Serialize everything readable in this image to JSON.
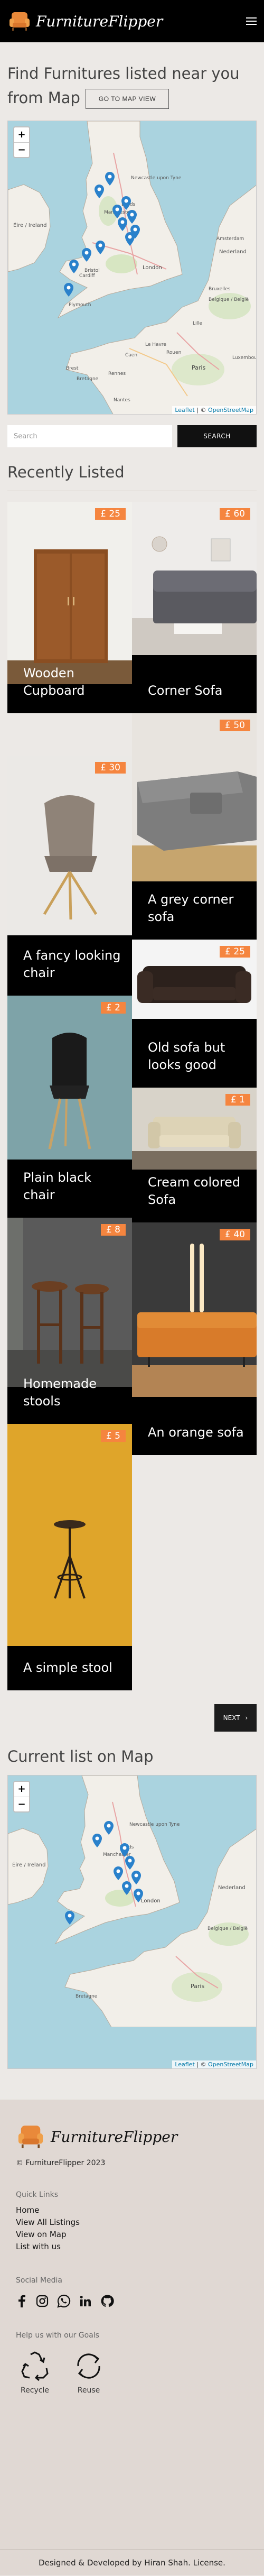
{
  "header": {
    "brand": "FurnitureFlipper"
  },
  "hero": {
    "title": "Find Furnitures listed near you from Map",
    "map_button": "GO TO MAP VIEW"
  },
  "map": {
    "zoom_in": "+",
    "zoom_out": "−",
    "attribution_leaflet": "Leaflet",
    "attribution_sep": " | © ",
    "attribution_osm": "OpenStreetMap",
    "place_labels": [
      "Newcastle upon Tyne",
      "Leeds",
      "Manchester",
      "Éire / Ireland",
      "Nederland",
      "Belgique / België",
      "Lille",
      "Paris",
      "Rouen",
      "Le Havre",
      "Caen",
      "Rennes",
      "Nantes",
      "Bretagne",
      "Brest",
      "Luxembourg",
      "Bruxelles",
      "Amsterdam",
      "Cardiff",
      "London",
      "Plymouth",
      "Bristol"
    ]
  },
  "search": {
    "placeholder": "Search",
    "button": "SEARCH"
  },
  "recent": {
    "title": "Recently Listed",
    "cards": [
      {
        "title": "Wooden Cupboard",
        "price": "£ 25"
      },
      {
        "title": "Corner Sofa",
        "price": "£ 60"
      },
      {
        "title": "A fancy looking chair",
        "price": "£ 30"
      },
      {
        "title": "A grey corner sofa",
        "price": "£ 50"
      },
      {
        "title": "Old sofa but looks good",
        "price": "£ 25"
      },
      {
        "title": "Plain black chair",
        "price": "£ 2"
      },
      {
        "title": "Cream colored Sofa",
        "price": "£ 1"
      },
      {
        "title": "Homemade stools",
        "price": "£ 8"
      },
      {
        "title": "An orange sofa",
        "price": "£ 40"
      },
      {
        "title": "A simple stool",
        "price": "£ 5"
      }
    ]
  },
  "pager": {
    "next": "NEXT"
  },
  "current": {
    "title": "Current list on Map"
  },
  "footer": {
    "brand": "FurnitureFlipper",
    "copyright": "© FurnitureFlipper 2023",
    "quick_links_title": "Quick Links",
    "links": [
      "Home",
      "View All Listings",
      "View on Map",
      "List with us"
    ],
    "social_title": "Social Media",
    "social_icons": [
      "facebook-icon",
      "instagram-icon",
      "whatsapp-icon",
      "linkedin-icon",
      "github-icon"
    ],
    "goals_title": "Help us with our Goals",
    "goals": [
      "Recycle",
      "Reuse"
    ],
    "credit": "Designed & Developed by Hiran Shah. License."
  },
  "colors": {
    "accent": "#f5853f",
    "header_bg": "#000000",
    "page_bg": "#ece9e6",
    "footer_bg": "#e0d8d3",
    "pin": "#2a81cb"
  }
}
